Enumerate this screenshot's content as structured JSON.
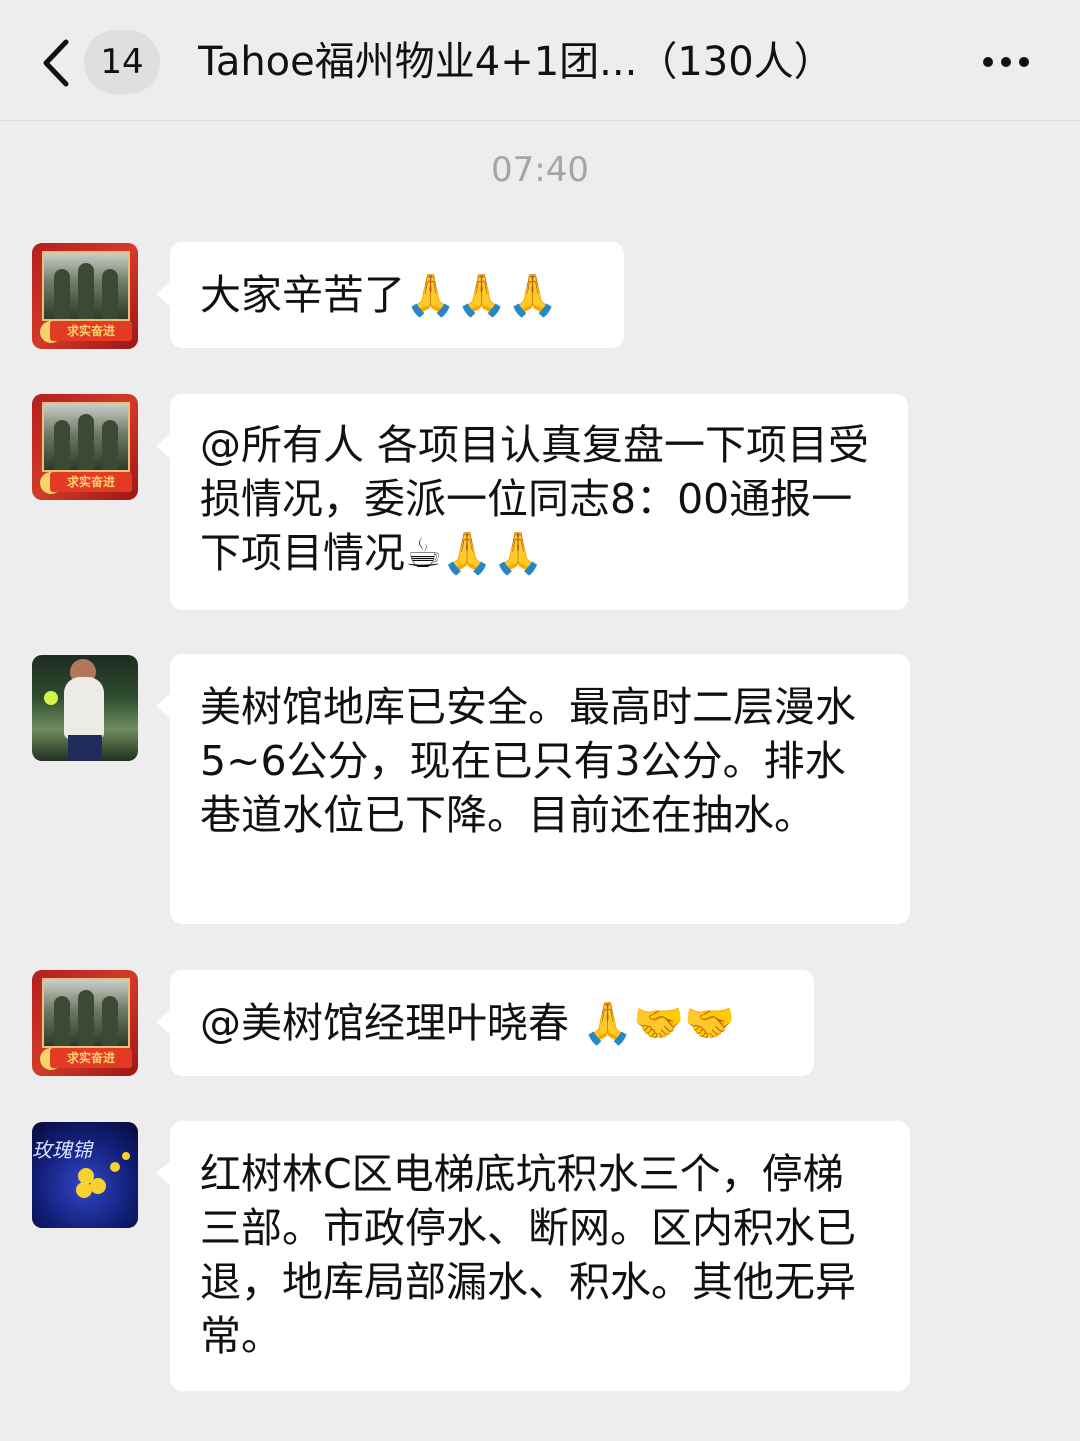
{
  "header": {
    "back_icon": "chevron-left-icon",
    "unread_count": "14",
    "title": "Tahoe福州物业4+1团...（130人）",
    "more_icon": "more-icon"
  },
  "timestamp": "07:40",
  "messages": [
    {
      "avatar": "red-banner-avatar",
      "text": "大家辛苦了🙏🙏🙏"
    },
    {
      "avatar": "red-banner-avatar",
      "text": "@所有人 各项目认真复盘一下项目受损情况，委派一位同志8：00通报一下项目情况☕🙏🙏"
    },
    {
      "avatar": "tennis-player-avatar",
      "text": "美树馆地库已安全。最高时二层漫水5~6公分，现在已只有3公分。排水巷道水位已下降。目前还在抽水。"
    },
    {
      "avatar": "red-banner-avatar",
      "text": "@美树馆经理叶晓春 🙏🤝🤝"
    },
    {
      "avatar": "flower-avatar",
      "text": "红树林C区电梯底坑积水三个，停梯三部。市政停水、断网。区内积水已退，地库局部漏水、积水。其他无异常。"
    }
  ],
  "avatar_red_banner_text": "求实奋进",
  "avatar_flower_text": "玫瑰锦"
}
